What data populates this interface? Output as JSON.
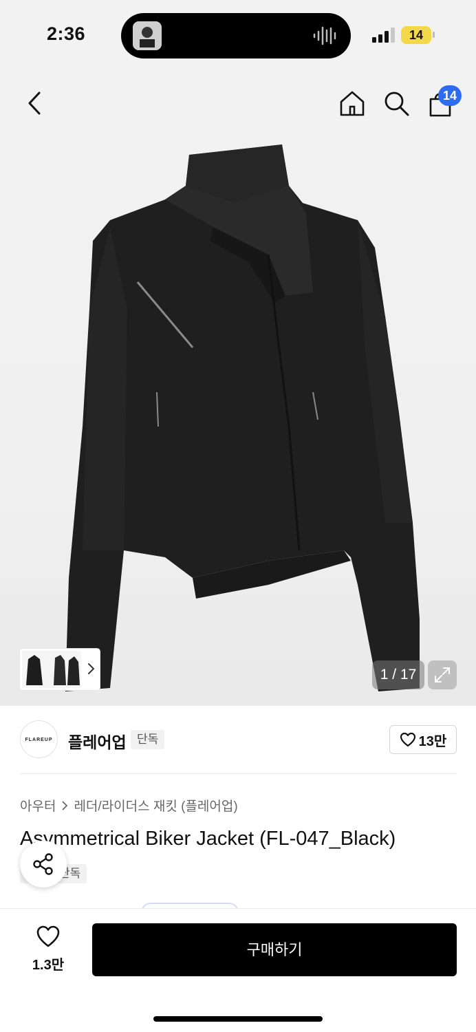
{
  "status_bar": {
    "time": "2:36",
    "battery": "14"
  },
  "header": {
    "cart_count": "14"
  },
  "gallery": {
    "counter": "1 / 17"
  },
  "brand": {
    "logo_text": "FLAREUP",
    "name": "플레어업",
    "tag": "단독",
    "likes": "13만"
  },
  "product": {
    "breadcrumb": [
      "아우터",
      "레더/라이더스 재킷 (플레어업)"
    ],
    "title": "Asymmetrical Biker Jacket (FL-047_Black)",
    "badge": "단독"
  },
  "bottom_bar": {
    "wish_count": "1.3만",
    "buy_label": "구매하기"
  },
  "colors": {
    "accent_badge": "#2f6bf0",
    "battery": "#f3d94a",
    "buy_button": "#000000"
  },
  "icons": [
    "back-icon",
    "home-icon",
    "search-icon",
    "bag-icon",
    "expand-icon",
    "heart-icon",
    "share-icon",
    "chevron-right-icon"
  ]
}
